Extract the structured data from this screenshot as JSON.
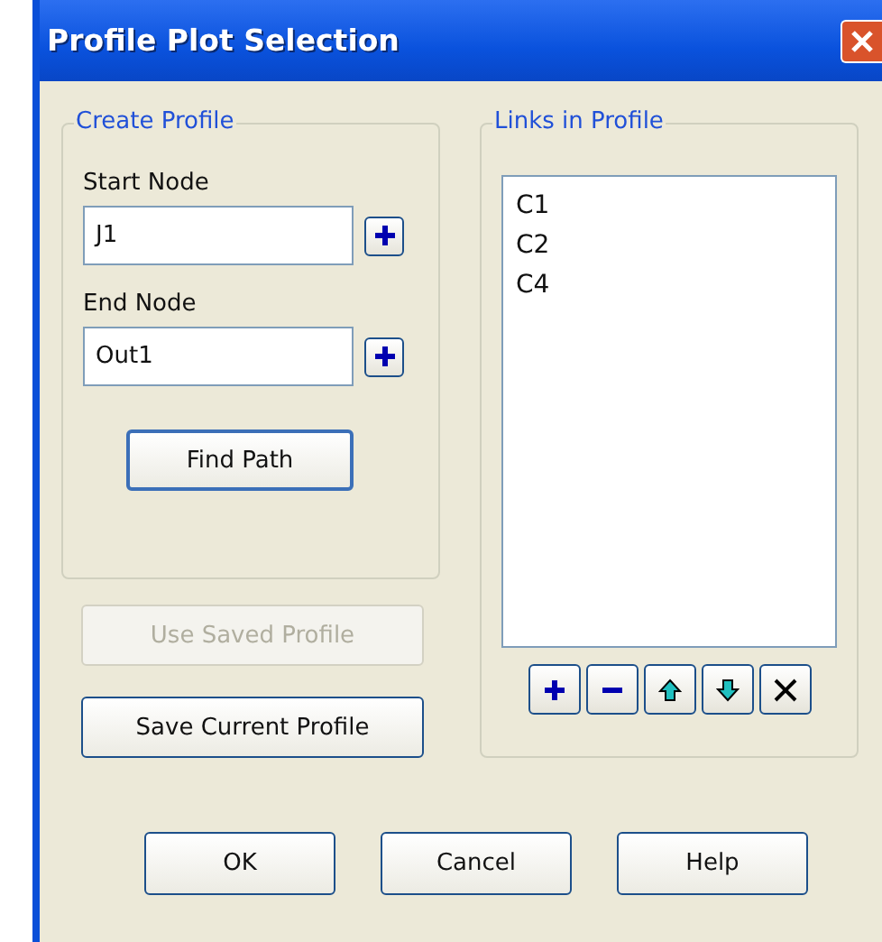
{
  "window": {
    "title": "Profile Plot Selection"
  },
  "create_profile": {
    "title": "Create Profile",
    "start_node": {
      "label": "Start Node",
      "value": "J1"
    },
    "end_node": {
      "label": "End Node",
      "value": "Out1"
    },
    "find_path": {
      "label": "Find Path",
      "default": true
    }
  },
  "side_buttons": [
    {
      "label": "Use Saved Profile",
      "disabled": true
    },
    {
      "label": "Save Current Profile",
      "disabled": false
    }
  ],
  "links_in_profile": {
    "title": "Links in Profile",
    "items": [
      "C1",
      "C2",
      "C4"
    ],
    "tools": [
      {
        "kind": "add"
      },
      {
        "kind": "remove"
      },
      {
        "kind": "up"
      },
      {
        "kind": "down"
      },
      {
        "kind": "clear"
      }
    ]
  },
  "buttons": [
    "OK",
    "Cancel",
    "Help"
  ]
}
